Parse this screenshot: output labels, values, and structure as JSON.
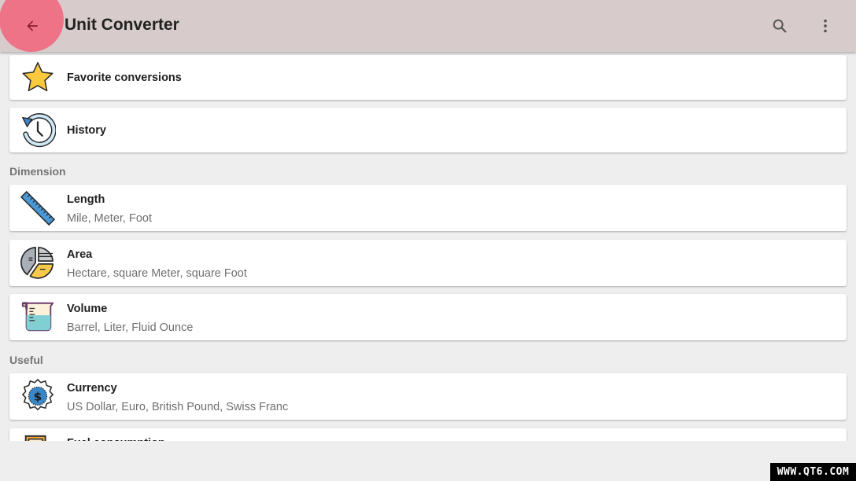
{
  "appbar": {
    "title": "Unit Converter",
    "back_icon": "arrow-back-icon",
    "search_icon": "search-icon",
    "menu_icon": "more-vert-icon",
    "accent_color": "#ef7386",
    "bar_color": "#d7cccb"
  },
  "top_items": [
    {
      "title": "Favorite conversions",
      "icon": "star-icon"
    },
    {
      "title": "History",
      "icon": "history-icon"
    }
  ],
  "sections": [
    {
      "header": "Dimension",
      "items": [
        {
          "title": "Length",
          "subtitle": "Mile, Meter, Foot",
          "icon": "ruler-icon"
        },
        {
          "title": "Area",
          "subtitle": "Hectare, square Meter, square Foot",
          "icon": "area-chart-icon"
        },
        {
          "title": "Volume",
          "subtitle": "Barrel, Liter, Fluid Ounce",
          "icon": "beaker-icon"
        }
      ]
    },
    {
      "header": "Useful",
      "items": [
        {
          "title": "Currency",
          "subtitle": "US Dollar, Euro, British Pound, Swiss Franc",
          "icon": "currency-badge-icon"
        },
        {
          "title": "Fuel consumption",
          "subtitle": "",
          "icon": "fuel-pump-icon"
        }
      ]
    }
  ],
  "watermark": "WWW.QT6.COM"
}
